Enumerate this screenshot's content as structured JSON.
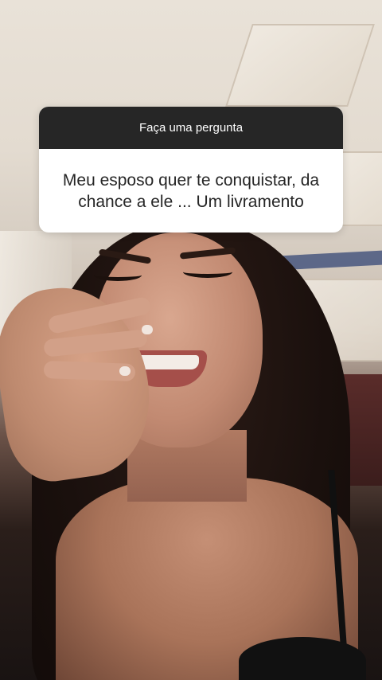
{
  "story": {
    "question_sticker": {
      "title": "Faça uma pergunta",
      "question": "Meu esposo quer te conquistar, da chance a ele ... Um livramento"
    }
  },
  "colors": {
    "sticker_header_bg": "#262626",
    "sticker_header_text": "#ffffff",
    "sticker_body_bg": "#ffffff",
    "sticker_body_text": "#262626"
  }
}
